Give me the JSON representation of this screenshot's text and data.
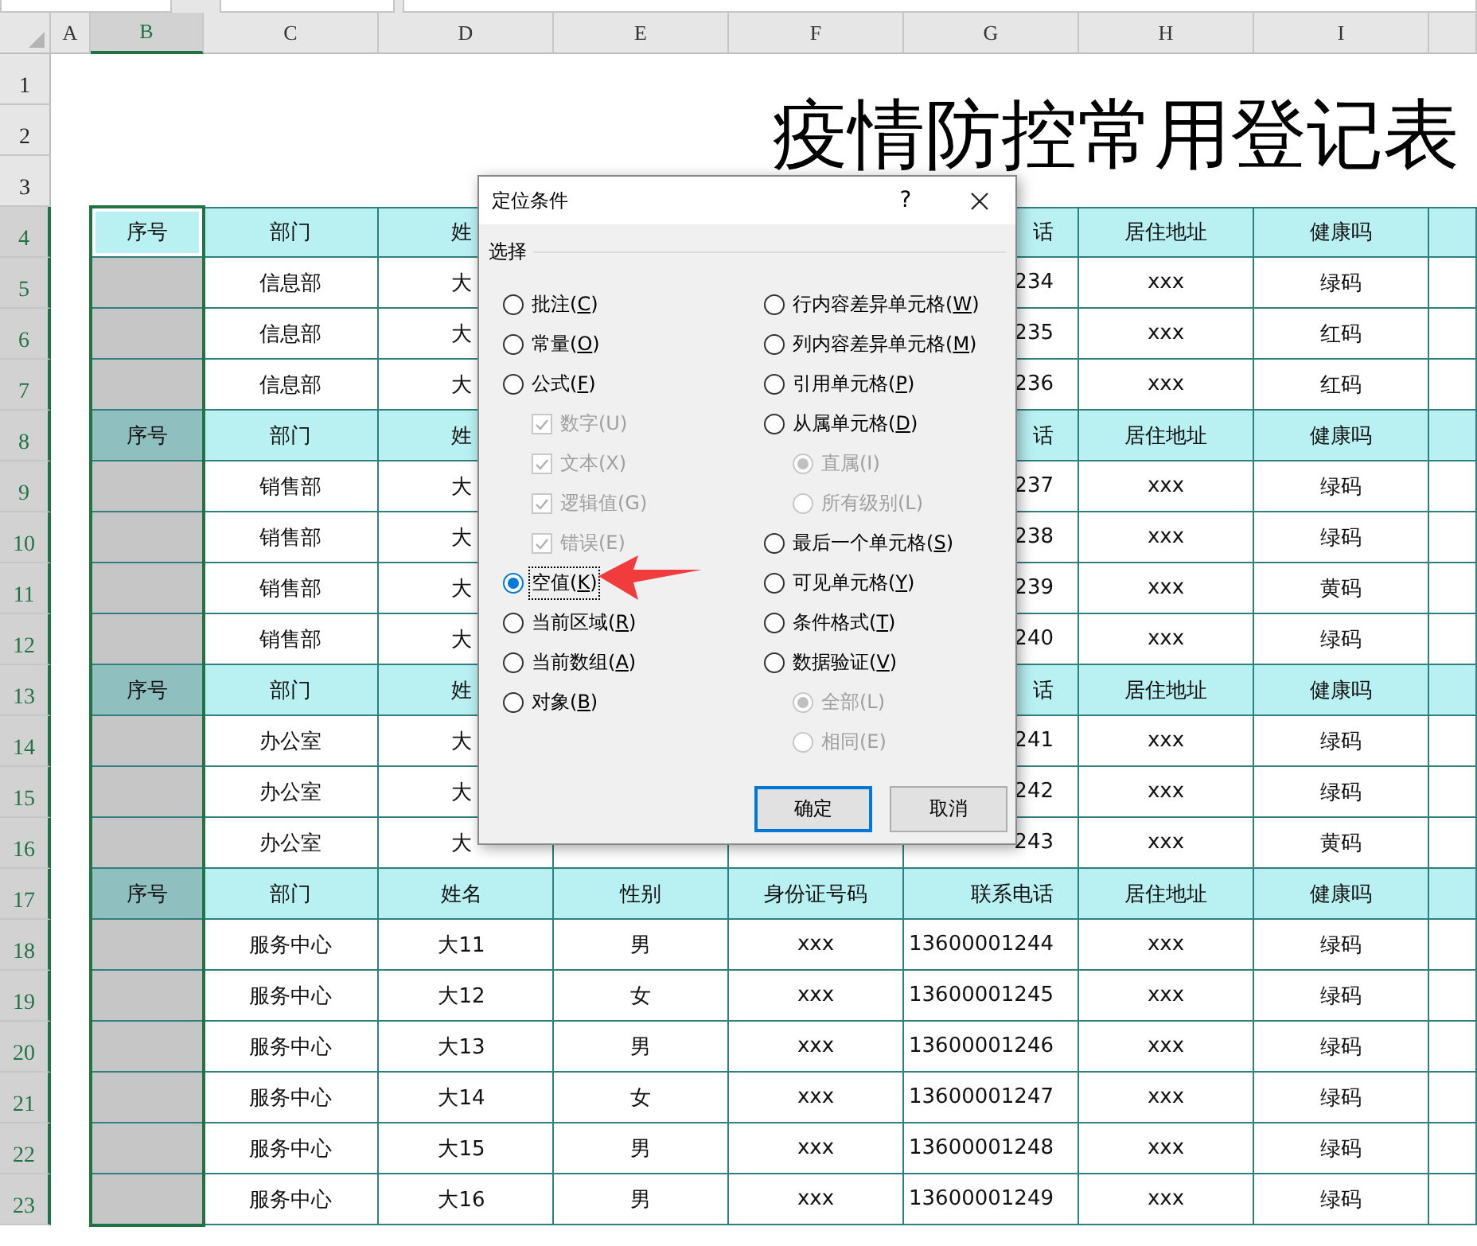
{
  "sheet": {
    "columns": [
      {
        "label": "A",
        "selected": false
      },
      {
        "label": "B",
        "selected": true
      },
      {
        "label": "C",
        "selected": false
      },
      {
        "label": "D",
        "selected": false
      },
      {
        "label": "E",
        "selected": false
      },
      {
        "label": "F",
        "selected": false
      },
      {
        "label": "G",
        "selected": false
      },
      {
        "label": "H",
        "selected": false
      },
      {
        "label": "I",
        "selected": false
      }
    ],
    "title": "疫情防控常用登记表",
    "rows": [
      {
        "number": "1",
        "selected": false
      },
      {
        "number": "2",
        "selected": false
      },
      {
        "number": "3",
        "selected": false
      },
      {
        "number": "4",
        "selected": true,
        "active": true,
        "kind": "header",
        "cells": {
          "B": "序号",
          "C": "部门",
          "D": "姓",
          "G": "话",
          "H": "居住地址",
          "I": "健康吗"
        }
      },
      {
        "number": "5",
        "selected": true,
        "active": false,
        "kind": "data",
        "cells": {
          "C": "信息部",
          "D": "大",
          "G": "234",
          "H": "xxx",
          "I": "绿码"
        }
      },
      {
        "number": "6",
        "selected": true,
        "active": false,
        "kind": "data",
        "cells": {
          "C": "信息部",
          "D": "大",
          "G": "235",
          "H": "xxx",
          "I": "红码"
        }
      },
      {
        "number": "7",
        "selected": true,
        "active": false,
        "kind": "data",
        "cells": {
          "C": "信息部",
          "D": "大",
          "G": "236",
          "H": "xxx",
          "I": "红码"
        }
      },
      {
        "number": "8",
        "selected": true,
        "active": false,
        "kind": "header",
        "cells": {
          "B": "序号",
          "C": "部门",
          "D": "姓",
          "G": "话",
          "H": "居住地址",
          "I": "健康吗"
        }
      },
      {
        "number": "9",
        "selected": true,
        "active": false,
        "kind": "data",
        "cells": {
          "C": "销售部",
          "D": "大",
          "G": "237",
          "H": "xxx",
          "I": "绿码"
        }
      },
      {
        "number": "10",
        "selected": true,
        "active": false,
        "kind": "data",
        "cells": {
          "C": "销售部",
          "D": "大",
          "G": "238",
          "H": "xxx",
          "I": "绿码"
        }
      },
      {
        "number": "11",
        "selected": true,
        "active": false,
        "kind": "data",
        "cells": {
          "C": "销售部",
          "D": "大",
          "G": "239",
          "H": "xxx",
          "I": "黄码"
        }
      },
      {
        "number": "12",
        "selected": true,
        "active": false,
        "kind": "data",
        "cells": {
          "C": "销售部",
          "D": "大",
          "G": "240",
          "H": "xxx",
          "I": "绿码"
        }
      },
      {
        "number": "13",
        "selected": true,
        "active": false,
        "kind": "header",
        "cells": {
          "B": "序号",
          "C": "部门",
          "D": "姓",
          "G": "话",
          "H": "居住地址",
          "I": "健康吗"
        }
      },
      {
        "number": "14",
        "selected": true,
        "active": false,
        "kind": "data",
        "cells": {
          "C": "办公室",
          "D": "大",
          "G": "241",
          "H": "xxx",
          "I": "绿码"
        }
      },
      {
        "number": "15",
        "selected": true,
        "active": false,
        "kind": "data",
        "cells": {
          "C": "办公室",
          "D": "大",
          "G": "242",
          "H": "xxx",
          "I": "绿码"
        }
      },
      {
        "number": "16",
        "selected": true,
        "active": false,
        "kind": "data",
        "cells": {
          "C": "办公室",
          "D": "大",
          "G": "243",
          "H": "xxx",
          "I": "黄码"
        }
      },
      {
        "number": "17",
        "selected": true,
        "active": false,
        "kind": "header",
        "cells": {
          "B": "序号",
          "C": "部门",
          "D": "姓名",
          "E": "性别",
          "F": "身份证号码",
          "G": "联系电话",
          "H": "居住地址",
          "I": "健康吗"
        }
      },
      {
        "number": "18",
        "selected": true,
        "active": false,
        "kind": "data",
        "cells": {
          "C": "服务中心",
          "D": "大11",
          "E": "男",
          "F": "xxx",
          "G": "13600001244",
          "H": "xxx",
          "I": "绿码"
        }
      },
      {
        "number": "19",
        "selected": true,
        "active": false,
        "kind": "data",
        "cells": {
          "C": "服务中心",
          "D": "大12",
          "E": "女",
          "F": "xxx",
          "G": "13600001245",
          "H": "xxx",
          "I": "绿码"
        }
      },
      {
        "number": "20",
        "selected": true,
        "active": false,
        "kind": "data",
        "cells": {
          "C": "服务中心",
          "D": "大13",
          "E": "男",
          "F": "xxx",
          "G": "13600001246",
          "H": "xxx",
          "I": "绿码"
        }
      },
      {
        "number": "21",
        "selected": true,
        "active": false,
        "kind": "data",
        "cells": {
          "C": "服务中心",
          "D": "大14",
          "E": "女",
          "F": "xxx",
          "G": "13600001247",
          "H": "xxx",
          "I": "绿码"
        }
      },
      {
        "number": "22",
        "selected": true,
        "active": false,
        "kind": "data",
        "cells": {
          "C": "服务中心",
          "D": "大15",
          "E": "男",
          "F": "xxx",
          "G": "13600001248",
          "H": "xxx",
          "I": "绿码"
        }
      },
      {
        "number": "23",
        "selected": true,
        "active": false,
        "kind": "data",
        "cells": {
          "C": "服务中心",
          "D": "大16",
          "E": "男",
          "F": "xxx",
          "G": "13600001249",
          "H": "xxx",
          "I": "绿码"
        }
      }
    ]
  },
  "dialog": {
    "title": "定位条件",
    "help": "?",
    "group_label": "选择",
    "left": [
      {
        "kind": "radio",
        "label": "批注(C)",
        "selected": false,
        "disabled": false
      },
      {
        "kind": "radio",
        "label": "常量(O)",
        "selected": false,
        "disabled": false
      },
      {
        "kind": "radio",
        "label": "公式(F)",
        "selected": false,
        "disabled": false,
        "children": [
          {
            "kind": "checkbox",
            "label": "数字(U)",
            "checked": true,
            "disabled": true
          },
          {
            "kind": "checkbox",
            "label": "文本(X)",
            "checked": true,
            "disabled": true
          },
          {
            "kind": "checkbox",
            "label": "逻辑值(G)",
            "checked": true,
            "disabled": true
          },
          {
            "kind": "checkbox",
            "label": "错误(E)",
            "checked": true,
            "disabled": true
          }
        ]
      },
      {
        "kind": "radio",
        "label": "空值(K)",
        "selected": true,
        "disabled": false
      },
      {
        "kind": "radio",
        "label": "当前区域(R)",
        "selected": false,
        "disabled": false
      },
      {
        "kind": "radio",
        "label": "当前数组(A)",
        "selected": false,
        "disabled": false
      },
      {
        "kind": "radio",
        "label": "对象(B)",
        "selected": false,
        "disabled": false
      }
    ],
    "right": [
      {
        "kind": "radio",
        "label": "行内容差异单元格(W)",
        "selected": false,
        "disabled": false
      },
      {
        "kind": "radio",
        "label": "列内容差异单元格(M)",
        "selected": false,
        "disabled": false
      },
      {
        "kind": "radio",
        "label": "引用单元格(P)",
        "selected": false,
        "disabled": false
      },
      {
        "kind": "radio",
        "label": "从属单元格(D)",
        "selected": false,
        "disabled": false,
        "children": [
          {
            "kind": "radio",
            "label": "直属(I)",
            "selected": true,
            "disabled": true
          },
          {
            "kind": "radio",
            "label": "所有级别(L)",
            "selected": false,
            "disabled": true
          }
        ]
      },
      {
        "kind": "radio",
        "label": "最后一个单元格(S)",
        "selected": false,
        "disabled": false
      },
      {
        "kind": "radio",
        "label": "可见单元格(Y)",
        "selected": false,
        "disabled": false
      },
      {
        "kind": "radio",
        "label": "条件格式(T)",
        "selected": false,
        "disabled": false
      },
      {
        "kind": "radio",
        "label": "数据验证(V)",
        "selected": false,
        "disabled": false,
        "children": [
          {
            "kind": "radio",
            "label": "全部(L)",
            "selected": true,
            "disabled": true
          },
          {
            "kind": "radio",
            "label": "相同(E)",
            "selected": false,
            "disabled": true
          }
        ]
      }
    ],
    "buttons": [
      {
        "label": "确定",
        "default": true
      },
      {
        "label": "取消",
        "default": false
      }
    ]
  }
}
